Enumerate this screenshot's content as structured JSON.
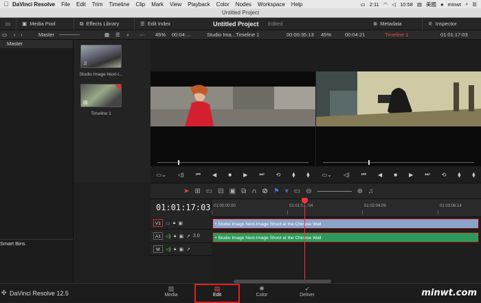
{
  "menubar": {
    "app_name": "DaVinci Resolve",
    "items": [
      "File",
      "Edit",
      "Trim",
      "Timeline",
      "Clip",
      "Mark",
      "View",
      "Playback",
      "Color",
      "Nodes",
      "Workspace",
      "Help"
    ],
    "time": "2:11",
    "clock": "10:58",
    "user": "minwt",
    "lang": "美國"
  },
  "window": {
    "title": "Untitled Project"
  },
  "toolbar": {
    "media_pool": "Media Pool",
    "effects_library": "Effects Library",
    "edit_index": "Edit Index",
    "project_name": "Untitled Project",
    "status": "Edited",
    "metadata": "Metadata",
    "inspector": "Inspector"
  },
  "bar2": {
    "bin": "Master",
    "zoom_left": "45%",
    "tc_left": "00:04:…",
    "clip_name": "Studio Ima...Timeline 1",
    "duration": "00:00:35:13",
    "zoom_right": "45%",
    "tc_mid": "00:04:21",
    "timeline_name": "Timeline 1",
    "tc_right": "01:01:17:03"
  },
  "left_panel": {
    "master": "Master",
    "smart_bins": "Smart Bins"
  },
  "media": [
    {
      "label": "Studio Image Next-I..."
    },
    {
      "label": "Timeline 1"
    }
  ],
  "timeline": {
    "timecode": "01:01:17:03",
    "ruler": [
      "01:00:00:00",
      "01:01:0…:04",
      "01:02:04:09",
      "01:03:06:14"
    ],
    "tracks": [
      {
        "id": "V1",
        "clip": "• Studio Image Next-Image Shoot at the Chinese Wall"
      },
      {
        "id": "A1",
        "level": "2.0",
        "clip": "• Studio Image Next-Image Shoot at the Chinese Wall"
      },
      {
        "id": "M"
      }
    ]
  },
  "bottom": {
    "brand": "DaVinci Resolve 12.5",
    "tabs": [
      "Media",
      "Edit",
      "Color",
      "Deliver"
    ],
    "active_tab": "Edit",
    "watermark": "minwt.com"
  },
  "colors": {
    "video_clip": "#8aa3c8",
    "audio_clip": "#2d9a5c",
    "playhead": "#e33344",
    "highlight": "#e02020"
  }
}
